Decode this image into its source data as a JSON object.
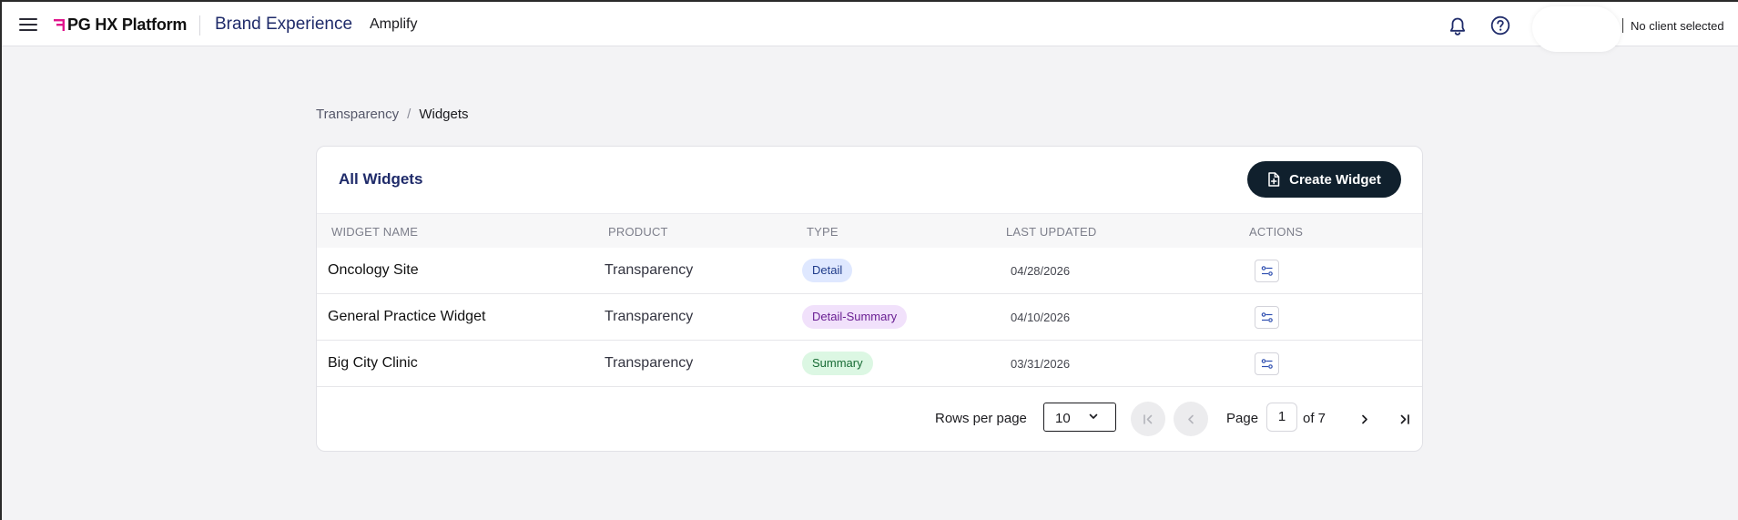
{
  "header": {
    "logo_text": "PG HX Platform",
    "brand_title": "Brand Experience",
    "app_name": "Amplify",
    "client_selector": "No client selected",
    "icons": [
      "menu-icon",
      "bell-icon",
      "help-icon"
    ]
  },
  "breadcrumb": {
    "items": [
      "Transparency",
      "Widgets"
    ],
    "separator": "/"
  },
  "card": {
    "title": "All Widgets",
    "create_button": "Create Widget"
  },
  "table": {
    "columns": [
      "WIDGET NAME",
      "PRODUCT",
      "TYPE",
      "LAST UPDATED",
      "ACTIONS"
    ],
    "rows": [
      {
        "name": "Oncology Site",
        "product": "Transparency",
        "type": "Detail",
        "type_color": "#dfe8ff",
        "type_text_color": "#1f3b8a",
        "updated": "04/28/2026"
      },
      {
        "name": "General Practice Widget",
        "product": "Transparency",
        "type": "Detail-Summary",
        "type_color": "#f1e1fb",
        "type_text_color": "#6a1f93",
        "updated": "04/10/2026"
      },
      {
        "name": "Big City Clinic",
        "product": "Transparency",
        "type": "Summary",
        "type_color": "#dcf7e3",
        "type_text_color": "#176b34",
        "updated": "03/31/2026"
      }
    ]
  },
  "pagination": {
    "rows_per_page_label": "Rows per page",
    "rows_per_page_value": "10",
    "page_label": "Page",
    "current_page": "1",
    "total_label": "of 7"
  },
  "colors": {
    "brand_accent": "#e0148c",
    "primary_dark": "#10202d",
    "title_blue": "#1f2b6a"
  }
}
